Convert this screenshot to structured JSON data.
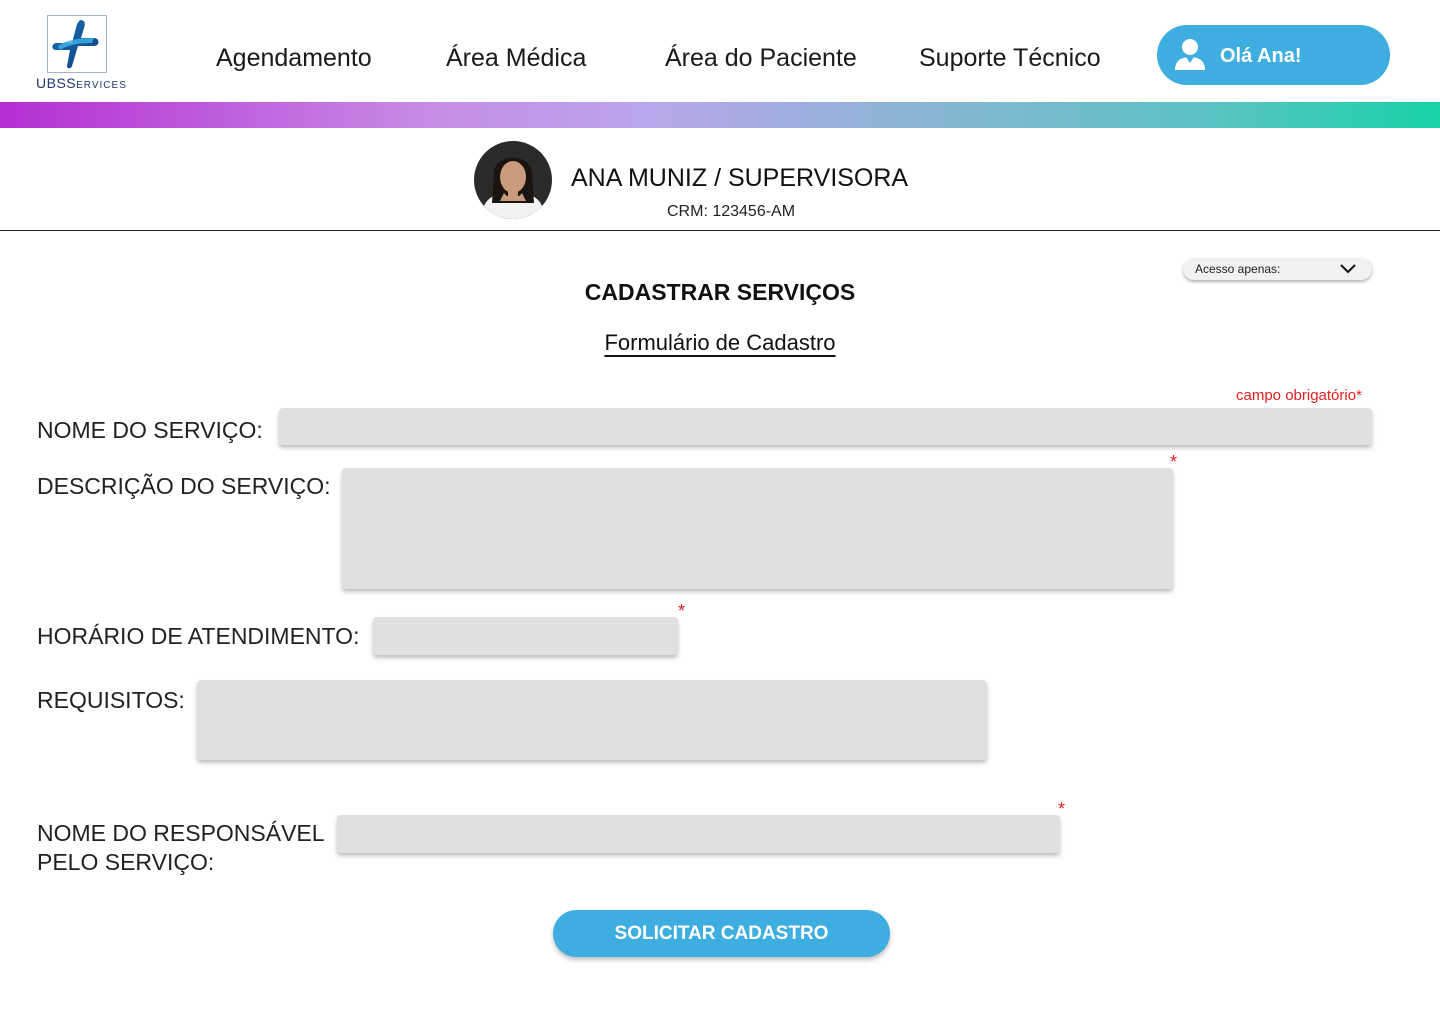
{
  "brand": {
    "logo_text_main": "UBS",
    "logo_text_small": "ERVICES",
    "logo_letter": "S"
  },
  "nav": {
    "items": [
      {
        "label": "Agendamento"
      },
      {
        "label": "Área Médica"
      },
      {
        "label": "Área do Paciente"
      },
      {
        "label": "Suporte Técnico"
      }
    ],
    "user_button": "Olá Ana!"
  },
  "profile": {
    "name": "ANA MUNIZ / SUPERVISORA",
    "crm": "CRM: 123456-AM"
  },
  "access_dropdown": {
    "label": "Acesso apenas:"
  },
  "page": {
    "title": "CADASTRAR SERVIÇOS",
    "subtitle": "Formulário de Cadastro",
    "required_note": "campo obrigatório*"
  },
  "form": {
    "service_name_label": "NOME DO SERVIÇO:",
    "description_label": "DESCRIÇÃO DO SERVIÇO:",
    "schedule_label": "HORÁRIO DE ATENDIMENTO:",
    "requirements_label": "REQUISITOS:",
    "responsible_label_line1": "NOME DO RESPONSÁVEL",
    "responsible_label_line2": "PELO SERVIÇO:",
    "required_mark": "*",
    "submit_label": "SOLICITAR CADASTRO"
  },
  "colors": {
    "accent": "#3eaee0",
    "required": "#e02020",
    "field_bg": "#e1dfdf"
  }
}
